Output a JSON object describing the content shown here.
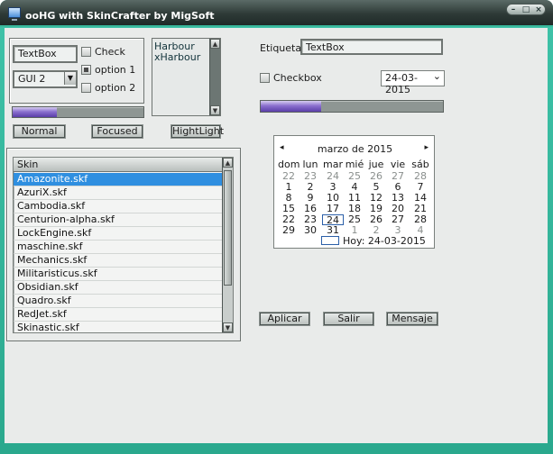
{
  "window": {
    "title": "ooHG with SkinCrafter by MigSoft",
    "min_glyph": "–",
    "max_glyph": "□",
    "close_glyph": "×"
  },
  "group1": {
    "textbox_value": "TextBox",
    "check_label": "Check",
    "combo_value": "GUI 2",
    "combo_arrow": "▼",
    "option1_label": "option 1",
    "option2_label": "option 2"
  },
  "listbox": {
    "items": [
      "Harbour",
      "xHarbour"
    ]
  },
  "progress1": {
    "fraction": 0.34
  },
  "buttons": {
    "normal": "Normal",
    "focused": "Focused",
    "highlight": "HightLight"
  },
  "right": {
    "label": "Etiqueta",
    "textbox_value": "TextBox",
    "checkbox_label": "Checkbox",
    "date_value": "24-03-2015",
    "date_arrow": "⌄"
  },
  "progress2": {
    "fraction": 0.33
  },
  "skins": {
    "header": "Skin",
    "rows": [
      "Amazonite.skf",
      "AzuriX.skf",
      "Cambodia.skf",
      "Centurion-alpha.skf",
      "LockEngine.skf",
      "maschine.skf",
      "Mechanics.skf",
      "Militaristicus.skf",
      "Obsidian.skf",
      "Quadro.skf",
      "RedJet.skf",
      "Skinastic.skf"
    ],
    "selected_index": 0
  },
  "calendar": {
    "prev": "◂",
    "next": "▸",
    "month_title": "marzo de 2015",
    "weekdays": [
      "dom",
      "lun",
      "mar",
      "mié",
      "jue",
      "vie",
      "sáb"
    ],
    "weeks": [
      [
        "22",
        "23",
        "24",
        "25",
        "26",
        "27",
        "28"
      ],
      [
        "1",
        "2",
        "3",
        "4",
        "5",
        "6",
        "7"
      ],
      [
        "8",
        "9",
        "10",
        "11",
        "12",
        "13",
        "14"
      ],
      [
        "15",
        "16",
        "17",
        "18",
        "19",
        "20",
        "21"
      ],
      [
        "22",
        "23",
        "24",
        "25",
        "26",
        "27",
        "28"
      ],
      [
        "29",
        "30",
        "31",
        "1",
        "2",
        "3",
        "4"
      ]
    ],
    "muted_cells": [
      [
        0,
        0
      ],
      [
        0,
        1
      ],
      [
        0,
        2
      ],
      [
        0,
        3
      ],
      [
        0,
        4
      ],
      [
        0,
        5
      ],
      [
        0,
        6
      ],
      [
        5,
        3
      ],
      [
        5,
        4
      ],
      [
        5,
        5
      ],
      [
        5,
        6
      ]
    ],
    "today_cell": [
      4,
      2
    ],
    "today_label": "Hoy: 24-03-2015"
  },
  "actions": {
    "apply": "Aplicar",
    "exit": "Salir",
    "message": "Mensaje"
  },
  "colors": {
    "frame": "#2aa88d",
    "selection": "#2f8fe0",
    "progress_fill": "#7c62c6"
  }
}
